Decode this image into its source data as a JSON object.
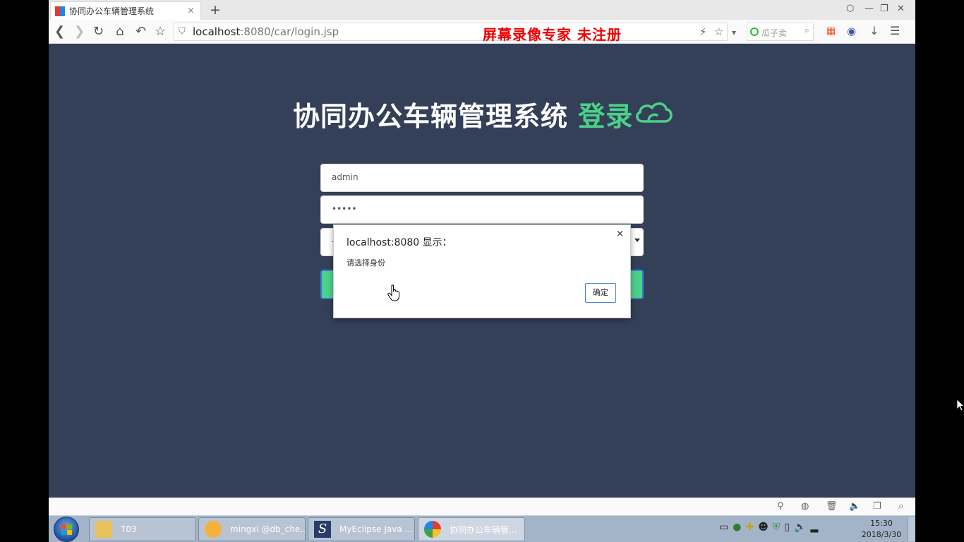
{
  "browser": {
    "tab_title": "协同办公车辆管理系统",
    "tab_close": "×",
    "new_tab": "+",
    "url_host": "localhost",
    "url_rest": ":8080/car/login.jsp",
    "recorder_watermark": "屏幕录像专家  未注册",
    "search_placeholder": "瓜子卖"
  },
  "page": {
    "title_main": "协同办公车辆管理系统",
    "title_accent": "登录",
    "username_value": "admin",
    "password_value": "•••••",
    "role_value": "--",
    "accent_color": "#4ad18a",
    "background_color": "#343f58"
  },
  "alert": {
    "title": "localhost:8080 显示：",
    "message": "请选择身份",
    "close": "×",
    "ok_label": "确定"
  },
  "taskbar": {
    "items": [
      {
        "label": "T03"
      },
      {
        "label": "mingxi @db_che..."
      },
      {
        "label": "MyEclipse Java ..."
      },
      {
        "label": "协同办公车辆管..."
      }
    ],
    "time": "15:30",
    "date": "2018/3/30"
  }
}
